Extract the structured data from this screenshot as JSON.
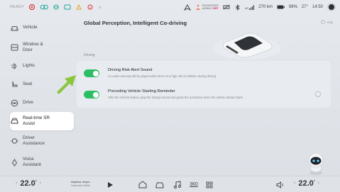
{
  "statusbar": {
    "ready": "READY",
    "airbag_line1": "PASSENGER",
    "airbag_line2": "AIRBAG",
    "airbag_state": "OFF",
    "signal": "4G",
    "range": "270 km",
    "battery": "98%",
    "temp": "27°",
    "time": "14:50"
  },
  "sidebar": {
    "items": [
      {
        "label": "Vehicle",
        "icon": "vehicle-icon"
      },
      {
        "label": "Window &\nDoor",
        "icon": "window-icon"
      },
      {
        "label": "Lights",
        "icon": "lights-icon"
      },
      {
        "label": "Seat",
        "icon": "seat-icon"
      },
      {
        "label": "Drive",
        "icon": "drive-icon"
      },
      {
        "label": "Real-time SR\nAssist",
        "icon": "sr-assist-icon",
        "active": true
      },
      {
        "label": "Driver\nAssistance",
        "icon": "driver-assistance-icon"
      },
      {
        "label": "Voice\nAssistant",
        "icon": "voice-icon"
      }
    ]
  },
  "main": {
    "title": "Global Perception, Intelligent Co-driving",
    "help": "Help",
    "section": "Driving",
    "rows": [
      {
        "title": "Driving Risk Alert Sound",
        "desc": "An audio warning will be played when there is a high risk of collision during driving.",
        "on": true
      },
      {
        "title": "Preceding Vehicle Starting Reminder",
        "desc": "After the vehicle brakes, play the startup sound and guide the animation when the vehicle ahead starts.",
        "on": true
      }
    ]
  },
  "dock": {
    "temp_left": "22.0",
    "temp_right": "22.0",
    "deg": "°",
    "song": "Anyhow, Anyw...",
    "artist": "Unknown Artist",
    "view360": "360"
  },
  "colors": {
    "toggle_on": "#2cbe65",
    "arrow": "#8cc63f",
    "active_bg": "#ffffff"
  }
}
